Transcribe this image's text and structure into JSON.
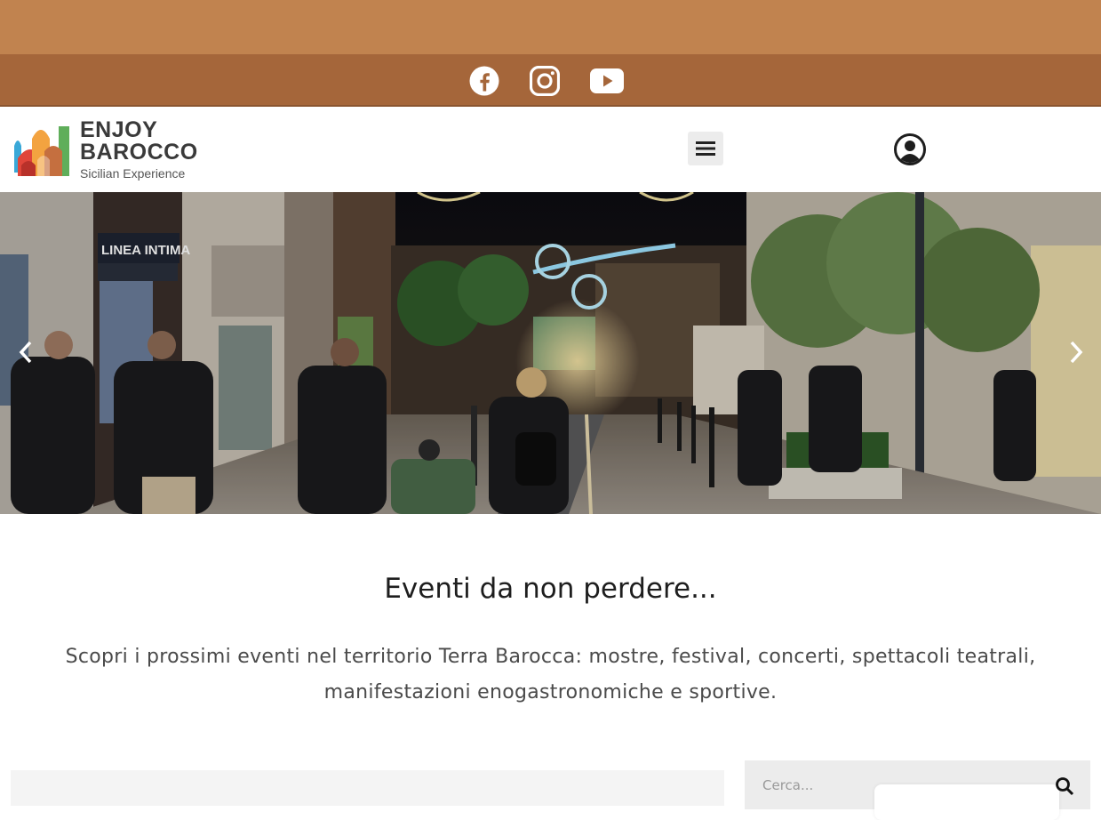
{
  "social": {
    "icons": [
      "facebook-icon",
      "instagram-icon",
      "youtube-icon"
    ]
  },
  "brand": {
    "line1": "ENJOY",
    "line2": "BAROCCO",
    "tagline": "Sicilian Experience"
  },
  "header": {
    "menu_icon": "hamburger-icon",
    "user_icon": "user-icon"
  },
  "hero": {
    "shop_sign": "LINEA INTIMA",
    "prev_icon": "chevron-left-icon",
    "next_icon": "chevron-right-icon"
  },
  "events": {
    "title": "Eventi da non perdere...",
    "description_line1": "Scopri i prossimi eventi nel territorio Terra Barocca: mostre, festival, concerti, spettacoli teatrali,",
    "description_line2": "manifestazioni enogastronomiche e sportive."
  },
  "search": {
    "placeholder": "Cerca...",
    "icon": "search-icon"
  },
  "colors": {
    "top_strip": "#c1834f",
    "social_bar": "#a5663a",
    "search_bg": "#ececec"
  }
}
